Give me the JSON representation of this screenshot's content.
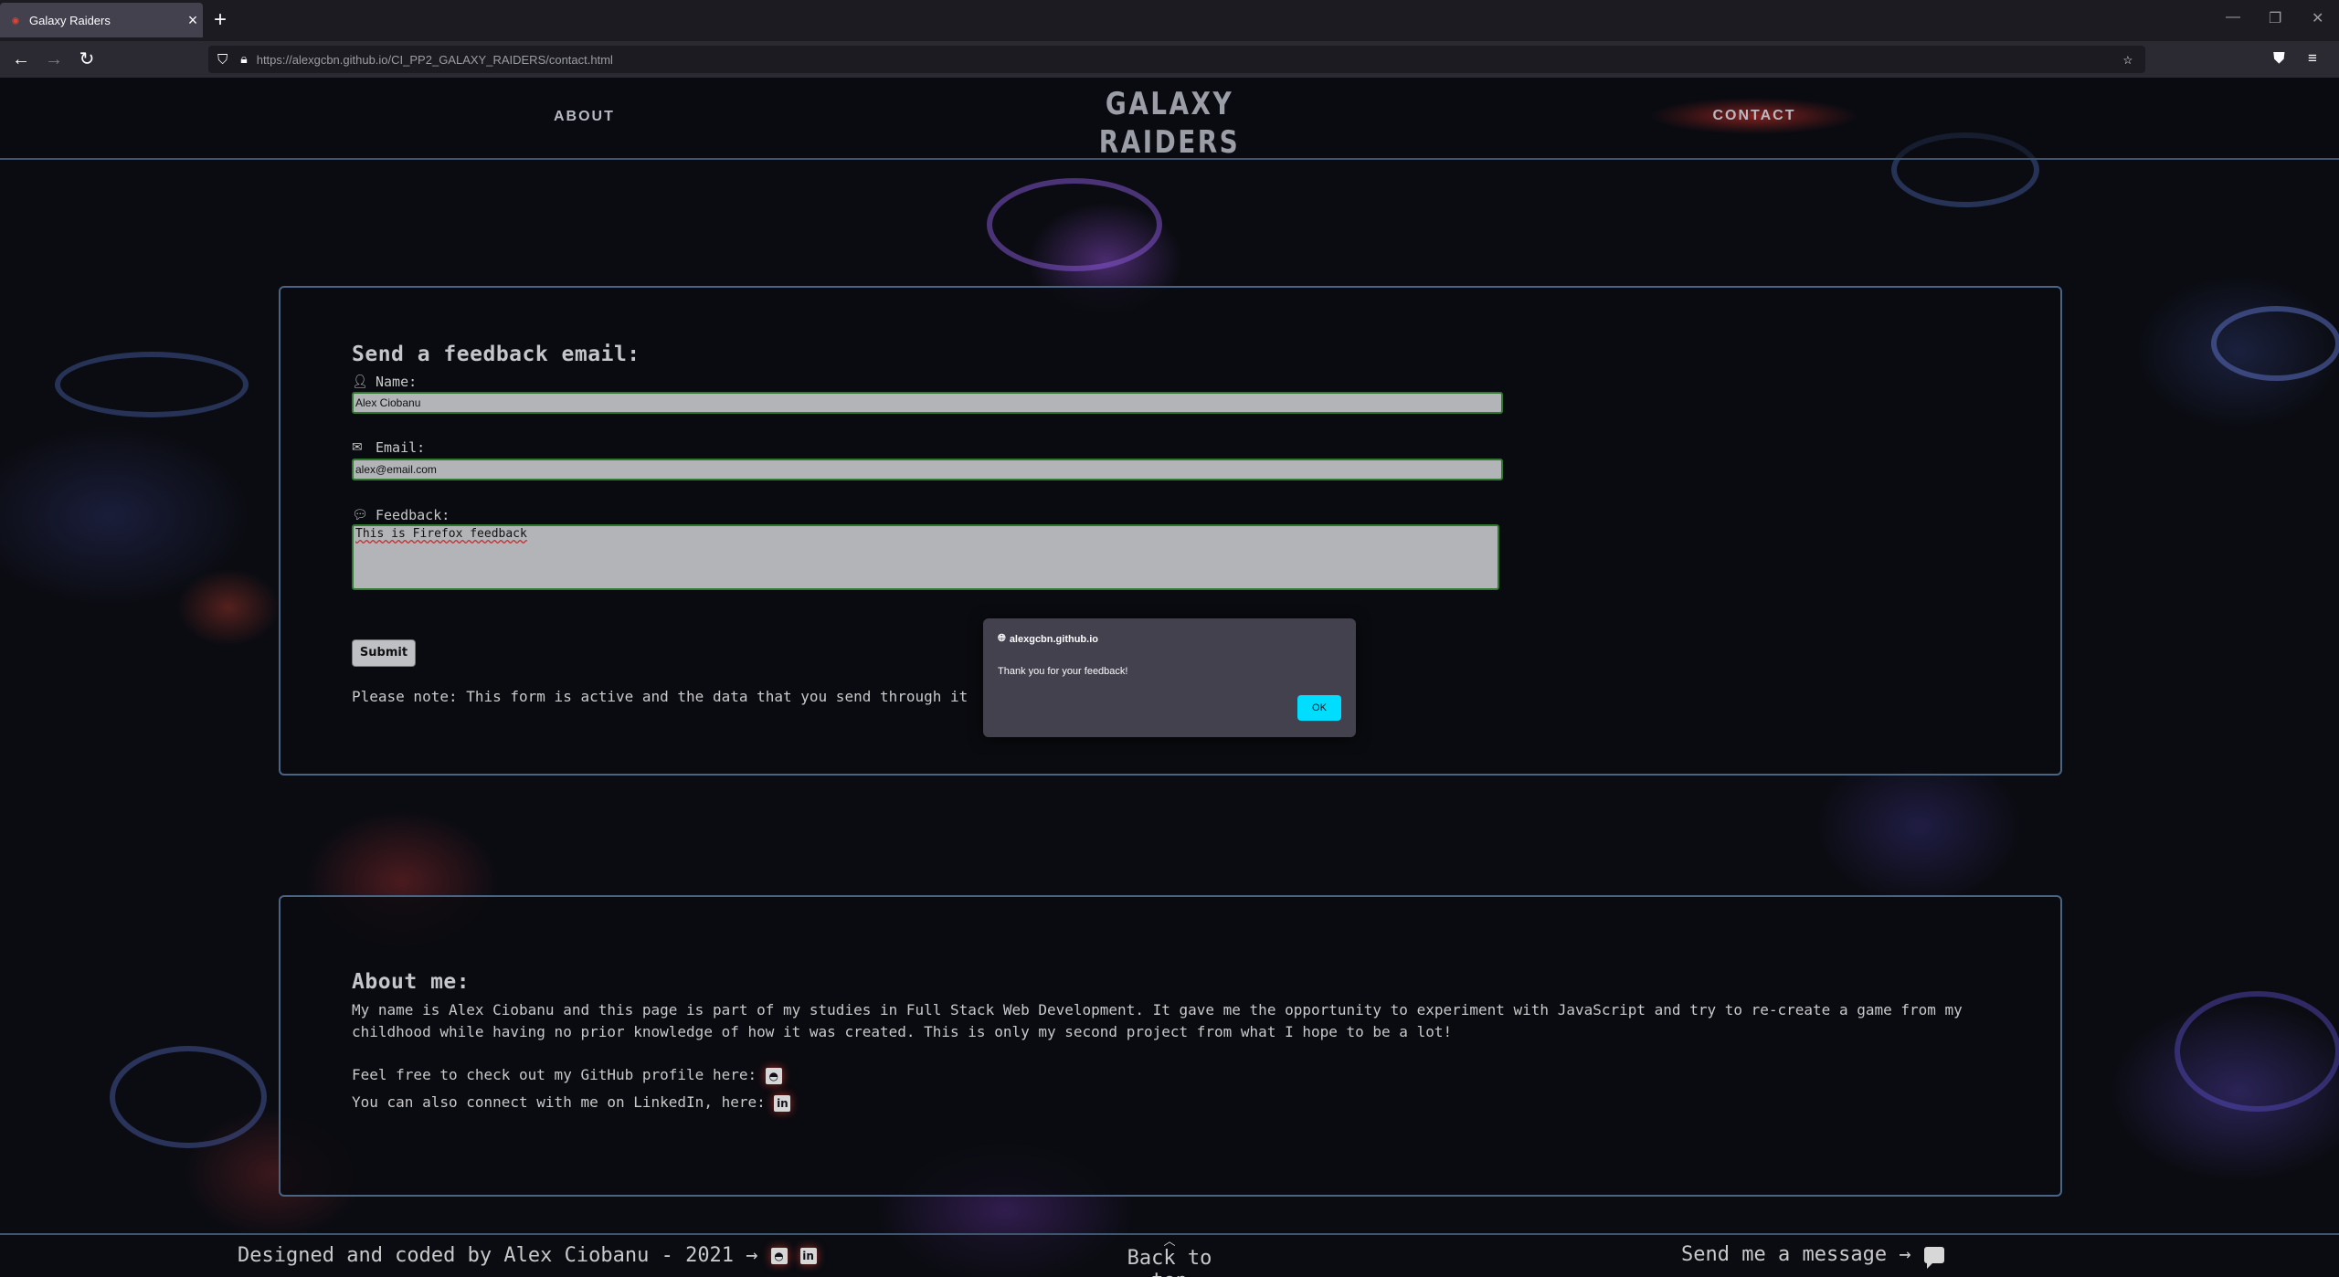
{
  "browser": {
    "tab_title": "Galaxy Raiders",
    "new_tab": "+",
    "url_host": "https://alexgcbn.github.io",
    "url_path": "/CI_PP2_GALAXY_RAIDERS/contact.html"
  },
  "nav": {
    "about": "ABOUT",
    "logo_line1": "GALAXY",
    "logo_line2": "RAIDERS",
    "contact": "CONTACT"
  },
  "form": {
    "heading": "Send a feedback email:",
    "name_label": "Name:",
    "name_value": "Alex Ciobanu",
    "email_label": "Email:",
    "email_value": "alex@email.com",
    "feedback_label": "Feedback:",
    "feedback_value": "This is Firefox feedback",
    "submit_label": "Submit",
    "note": "Please note: This form is active and the data that you send through it"
  },
  "dialog": {
    "origin": "alexgcbn.github.io",
    "message": "Thank you for your feedback!",
    "ok_label": "OK"
  },
  "about": {
    "heading": "About me:",
    "paragraph": "My name is Alex Ciobanu and this page is part of my studies in Full Stack Web Development. It gave me the opportunity to experiment with JavaScript and try to re-create a game from my childhood while having no prior knowledge of how it was created. This is only my second project from what I hope to be a lot!",
    "github_text": "Feel free to check out my GitHub profile here:",
    "linkedin_text": "You can also connect with me on LinkedIn, here:"
  },
  "footer": {
    "credit": "Designed and coded by Alex Ciobanu - 2021 →",
    "back_to_top": "Back to top",
    "message": "Send me a message →"
  },
  "colors": {
    "page_bg": "#0b0c12",
    "panel_border": "#4a6484",
    "ok_button": "#00ddff",
    "contact_glow": "#e63228",
    "input_border": "#2f7a2f"
  },
  "icons": [
    "user-icon",
    "envelope-icon",
    "comment-icon",
    "github-icon",
    "linkedin-icon",
    "chevron-up-icon",
    "chat-icon",
    "globe-icon"
  ]
}
